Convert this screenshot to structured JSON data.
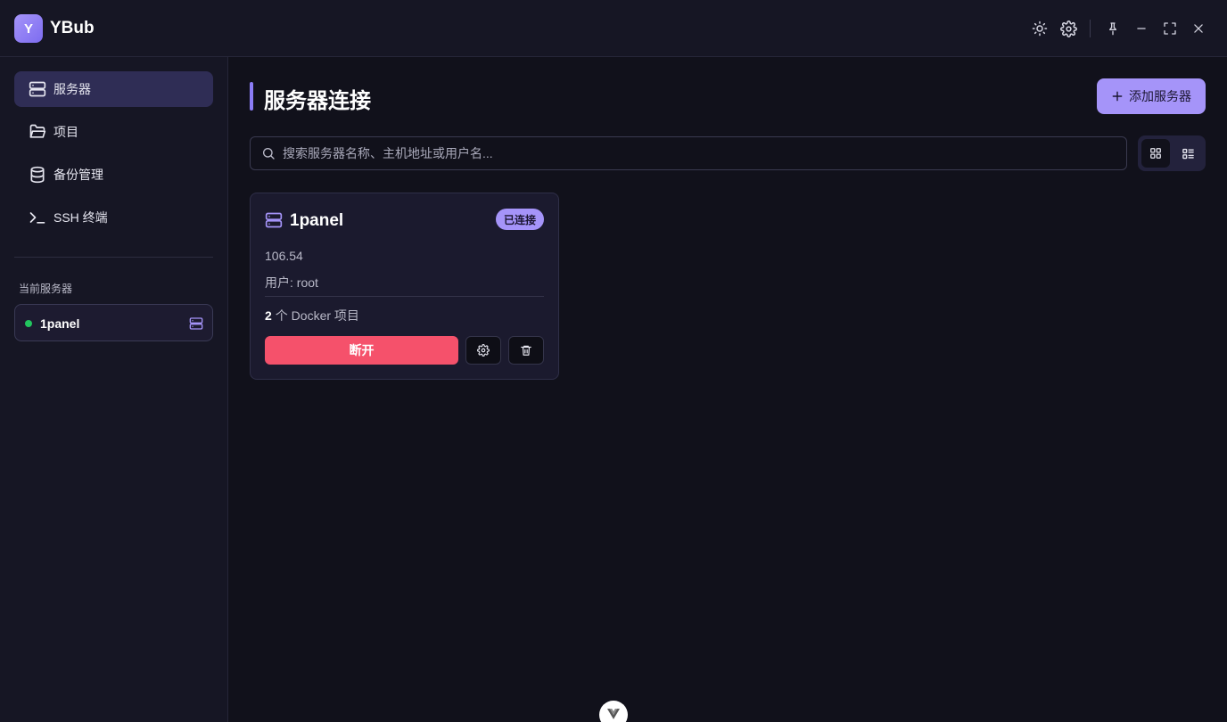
{
  "app": {
    "logo_letter": "Y",
    "name": "YBub"
  },
  "titlebar": {
    "icons": [
      "sun-icon",
      "gear-icon",
      "pin-icon",
      "minimize-icon",
      "maximize-icon",
      "close-icon"
    ]
  },
  "sidebar": {
    "items": [
      {
        "label": "服务器",
        "icon": "server-icon",
        "active": true
      },
      {
        "label": "项目",
        "icon": "folder-icon",
        "active": false
      },
      {
        "label": "备份管理",
        "icon": "database-icon",
        "active": false
      },
      {
        "label": "SSH 终端",
        "icon": "terminal-icon",
        "active": false
      }
    ],
    "section_label": "当前服务器",
    "current_server": {
      "name": "1panel",
      "status_color": "#22c55e"
    }
  },
  "main": {
    "title": "服务器连接",
    "add_button_label": "添加服务器",
    "search": {
      "placeholder": "搜索服务器名称、主机地址或用户名...",
      "value": ""
    },
    "view_mode": "grid"
  },
  "servers": [
    {
      "name": "1panel",
      "status": "已连接",
      "host": "106.54",
      "user": "用户: root",
      "project_count": "2",
      "project_suffix": "个 Docker 项目",
      "disconnect_label": "断开"
    }
  ],
  "colors": {
    "accent": "#a594f9",
    "danger": "#f5516b",
    "background": "#11111b",
    "online": "#22c55e"
  }
}
